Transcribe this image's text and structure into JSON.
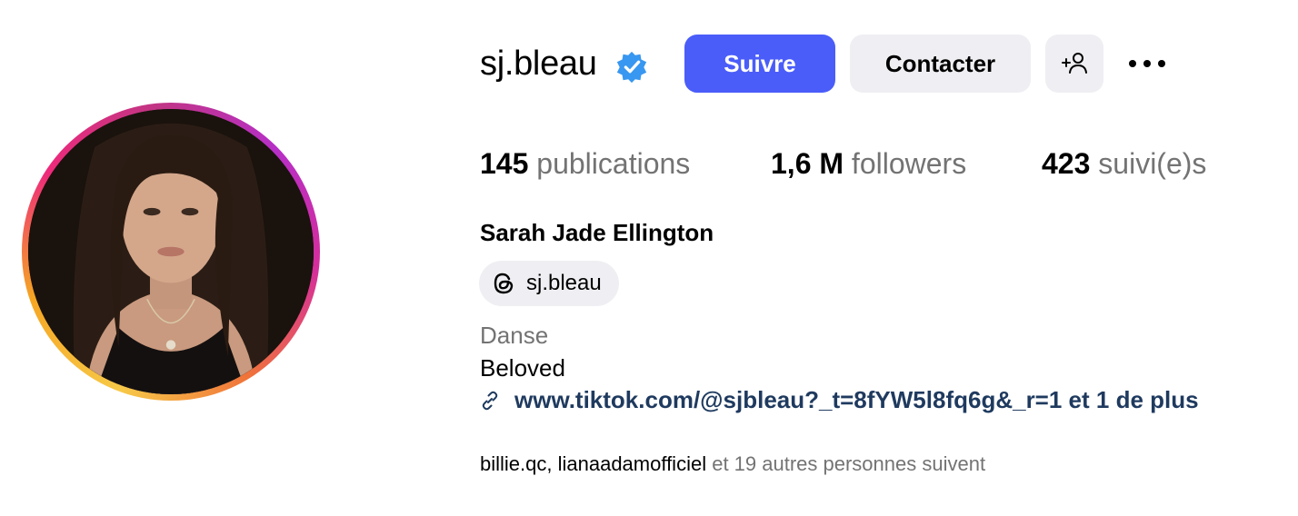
{
  "profile": {
    "username": "sj.bleau",
    "full_name": "Sarah Jade Ellington",
    "verified": true,
    "threads_handle": "sj.bleau",
    "category": "Danse",
    "bio": "Beloved",
    "link": "www.tiktok.com/@sjbleau?_t=8fYW5l8fq6g&_r=1 et 1 de plus"
  },
  "actions": {
    "follow_label": "Suivre",
    "contact_label": "Contacter",
    "add_user_icon": "person-add-icon",
    "more_icon": "more-horizontal-icon"
  },
  "stats": {
    "posts_count": "145",
    "posts_label": "publications",
    "followers_count": "1,6 M",
    "followers_label": "followers",
    "following_count": "423",
    "following_label": "suivi(e)s"
  },
  "followed_by": {
    "user1": "billie.qc",
    "separator": ", ",
    "user2": "lianaadamofficiel",
    "suffix": " et 19 autres personnes suivent"
  },
  "colors": {
    "follow_button": "#4a5df9",
    "secondary_button": "#efeff3",
    "muted_text": "#737373",
    "link_text": "#1f3a5f",
    "verified_badge": "#3897f0"
  }
}
